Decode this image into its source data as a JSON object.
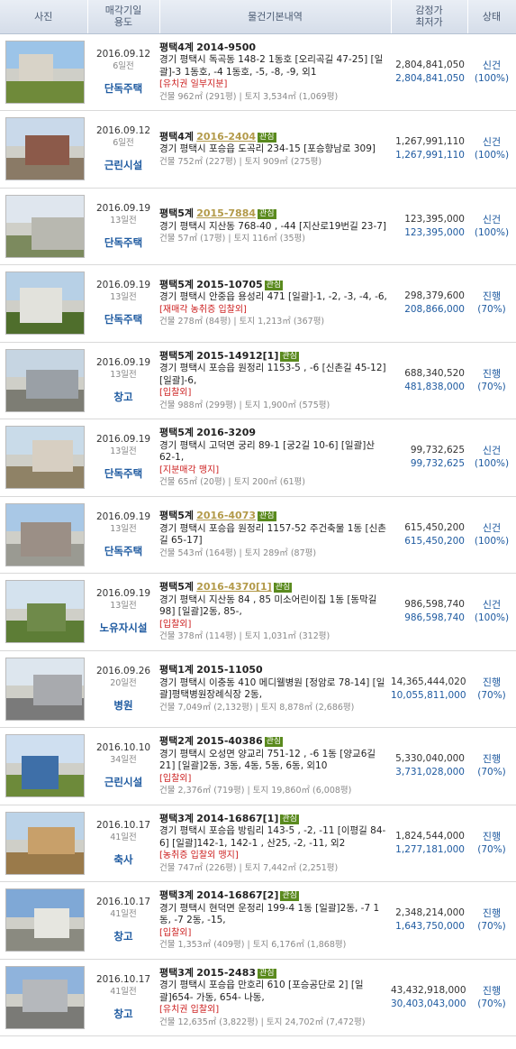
{
  "header": {
    "photo": "사진",
    "date_use": [
      "매각기일",
      "용도"
    ],
    "info": "물건기본내역",
    "price": [
      "감정가",
      "최저가"
    ],
    "status": "상태"
  },
  "rows": [
    {
      "date": "2016.09.12",
      "ago": "6일전",
      "kind": "단독주택",
      "court": "평택4계",
      "case": "2014-9500",
      "link": false,
      "badge": "",
      "addr": "경기 평택시 독곡동 148-2 1동호 [오리곡길 47-25] [일괄]-3 1동호, -4 1동호, -5, -8, -9, 외1",
      "tags": "[유치권  일부지분]",
      "area": "건물 962㎡ (291평) | 토지 3,534㎡ (1,069평)",
      "appraisal": "2,804,841,050",
      "minimum": "2,804,841,050",
      "status": "신건",
      "pct": "(100%)",
      "thumb": {
        "sky": "#9cc4e8",
        "ground": "#6f8a3a",
        "bldg": "#d8d3c8"
      }
    },
    {
      "date": "2016.09.12",
      "ago": "6일전",
      "kind": "근린시설",
      "court": "평택4계",
      "case": "2016-2404",
      "link": true,
      "badge": "관심",
      "addr": "경기 평택시 포승읍 도곡리 234-15 [포승향남로 309]",
      "tags": "",
      "area": "건물 752㎡ (227평) | 토지 909㎡ (275평)",
      "appraisal": "1,267,991,110",
      "minimum": "1,267,991,110",
      "status": "신건",
      "pct": "(100%)",
      "thumb": {
        "sky": "#c9d9ea",
        "ground": "#8a7a66",
        "bldg": "#8c5a4a"
      }
    },
    {
      "date": "2016.09.19",
      "ago": "13일전",
      "kind": "단독주택",
      "court": "평택5계",
      "case": "2015-7884",
      "link": true,
      "badge": "관심",
      "addr": "경기 평택시 지산동 768-40 , -44 [지산로19번길 23-7]",
      "tags": "",
      "area": "건물 57㎡ (17평) | 토지 116㎡ (35평)",
      "appraisal": "123,395,000",
      "minimum": "123,395,000",
      "status": "신건",
      "pct": "(100%)",
      "thumb": {
        "sky": "#dfe6ee",
        "ground": "#7c8a5e",
        "bldg": "#b8b8b0"
      }
    },
    {
      "date": "2016.09.19",
      "ago": "13일전",
      "kind": "단독주택",
      "court": "평택5계",
      "case": "2015-10705",
      "link": false,
      "badge": "관심",
      "addr": "경기 평택시 안중읍 용성리 471 [일괄]-1, -2, -3, -4, -6,",
      "tags": "[재매각  농취증  입찰외]",
      "area": "건물 278㎡ (84평) | 토지 1,213㎡ (367평)",
      "appraisal": "298,379,600",
      "minimum": "208,866,000",
      "status": "진행",
      "pct": "(70%)",
      "thumb": {
        "sky": "#b7d0e6",
        "ground": "#4f6e2c",
        "bldg": "#e2e2dc"
      }
    },
    {
      "date": "2016.09.19",
      "ago": "13일전",
      "kind": "창고",
      "court": "평택5계",
      "case": "2015-14912[1]",
      "link": false,
      "badge": "관심",
      "addr": "경기 평택시 포승읍 원정리 1153-5 , -6 [신촌길 45-12] [일괄]-6,",
      "tags": "[입찰외]",
      "area": "건물 988㎡ (299평) | 토지 1,900㎡ (575평)",
      "appraisal": "688,340,520",
      "minimum": "481,838,000",
      "status": "진행",
      "pct": "(70%)",
      "thumb": {
        "sky": "#c6d5e2",
        "ground": "#7d7d74",
        "bldg": "#9aa0a6"
      }
    },
    {
      "date": "2016.09.19",
      "ago": "13일전",
      "kind": "단독주택",
      "court": "평택5계",
      "case": "2016-3209",
      "link": false,
      "badge": "",
      "addr": "경기 평택시 고덕면 궁리 89-1 [궁2길 10-6] [일괄]산 62-1,",
      "tags": "[지분매각  맹지]",
      "area": "건물 65㎡ (20평) | 토지 200㎡ (61평)",
      "appraisal": "99,732,625",
      "minimum": "99,732,625",
      "status": "신건",
      "pct": "(100%)",
      "thumb": {
        "sky": "#c9dbe9",
        "ground": "#8f8266",
        "bldg": "#d7cfc2"
      }
    },
    {
      "date": "2016.09.19",
      "ago": "13일전",
      "kind": "단독주택",
      "court": "평택5계",
      "case": "2016-4073",
      "link": true,
      "badge": "관심",
      "addr": "경기 평택시 포승읍 원정리 1157-52 주건축물 1동 [신촌길 65-17]",
      "tags": "",
      "area": "건물 543㎡ (164평) | 토지 289㎡ (87평)",
      "appraisal": "615,450,200",
      "minimum": "615,450,200",
      "status": "신건",
      "pct": "(100%)",
      "thumb": {
        "sky": "#a9c8e6",
        "ground": "#9a9a92",
        "bldg": "#9b8f86"
      }
    },
    {
      "date": "2016.09.19",
      "ago": "13일전",
      "kind": "노유자시설",
      "court": "평택5계",
      "case": "2016-4370[1]",
      "link": true,
      "badge": "관심",
      "addr": "경기 평택시 지산동 84 , 85 미소어린이집 1동 [동막길 98] [일괄]2동, 85-,",
      "tags": "[입찰외]",
      "area": "건물 378㎡ (114평) | 토지 1,031㎡ (312평)",
      "appraisal": "986,598,740",
      "minimum": "986,598,740",
      "status": "신건",
      "pct": "(100%)",
      "thumb": {
        "sky": "#d4e2ee",
        "ground": "#5d7d36",
        "bldg": "#6f8a4a"
      }
    },
    {
      "date": "2016.09.26",
      "ago": "20일전",
      "kind": "병원",
      "court": "평택1계",
      "case": "2015-11050",
      "link": false,
      "badge": "",
      "addr": "경기 평택시 이충동 410 메디웰병원 [정암로 78-14] [일괄]평택병원장례식장 2동,",
      "tags": "",
      "area": "건물 7,049㎡ (2,132평) | 토지 8,878㎡ (2,686평)",
      "appraisal": "14,365,444,020",
      "minimum": "10,055,811,000",
      "status": "진행",
      "pct": "(70%)",
      "thumb": {
        "sky": "#dde6ee",
        "ground": "#7a7a7a",
        "bldg": "#a8aaae"
      }
    },
    {
      "date": "2016.10.10",
      "ago": "34일전",
      "kind": "근린시설",
      "court": "평택2계",
      "case": "2015-40386",
      "link": false,
      "badge": "관심",
      "addr": "경기 평택시 오성면 양교리 751-12 , -6 1동 [양교6길 21] [일괄]2동, 3동, 4동, 5동, 6동, 외10",
      "tags": "[입찰외]",
      "area": "건물 2,376㎡ (719평) | 토지 19,860㎡ (6,008평)",
      "appraisal": "5,330,040,000",
      "minimum": "3,731,028,000",
      "status": "진행",
      "pct": "(70%)",
      "thumb": {
        "sky": "#cfdff0",
        "ground": "#6d8a3a",
        "bldg": "#3e6fa8"
      }
    },
    {
      "date": "2016.10.17",
      "ago": "41일전",
      "kind": "축사",
      "court": "평택3계",
      "case": "2014-16867[1]",
      "link": false,
      "badge": "관심",
      "addr": "경기 평택시 포승읍 방림리 143-5 , -2, -11 [이평길 84-6] [일괄]142-1, 142-1 , 산25, -2, -11, 외2",
      "tags": "[농취증  입찰외  맹지]",
      "area": "건물 747㎡ (226평) | 토지 7,442㎡ (2,251평)",
      "appraisal": "1,824,544,000",
      "minimum": "1,277,181,000",
      "status": "진행",
      "pct": "(70%)",
      "thumb": {
        "sky": "#bcd3e8",
        "ground": "#9a7a4a",
        "bldg": "#c8a06a"
      }
    },
    {
      "date": "2016.10.17",
      "ago": "41일전",
      "kind": "창고",
      "court": "평택3계",
      "case": "2014-16867[2]",
      "link": false,
      "badge": "관심",
      "addr": "경기 평택시 현덕면 운정리 199-4 1동 [일괄]2동, -7 1동, -7 2동, -15,",
      "tags": "[입찰외]",
      "area": "건물 1,353㎡ (409평) | 토지 6,176㎡ (1,868평)",
      "appraisal": "2,348,214,000",
      "minimum": "1,643,750,000",
      "status": "진행",
      "pct": "(70%)",
      "thumb": {
        "sky": "#7fa8d6",
        "ground": "#8a8a80",
        "bldg": "#e6e6e0"
      }
    },
    {
      "date": "2016.10.17",
      "ago": "41일전",
      "kind": "창고",
      "court": "평택3계",
      "case": "2015-2483",
      "link": false,
      "badge": "관심",
      "addr": "경기 평택시 포승읍 만호리 610 [포승공단로 2] [일괄]654- 가동, 654- 나동,",
      "tags": "[유치권  입찰외]",
      "area": "건물 12,635㎡ (3,822평) | 토지 24,702㎡ (7,472평)",
      "appraisal": "43,432,918,000",
      "minimum": "30,403,043,000",
      "status": "진행",
      "pct": "(70%)",
      "thumb": {
        "sky": "#8fb3dc",
        "ground": "#7a7a76",
        "bldg": "#b5b8bc"
      }
    }
  ]
}
